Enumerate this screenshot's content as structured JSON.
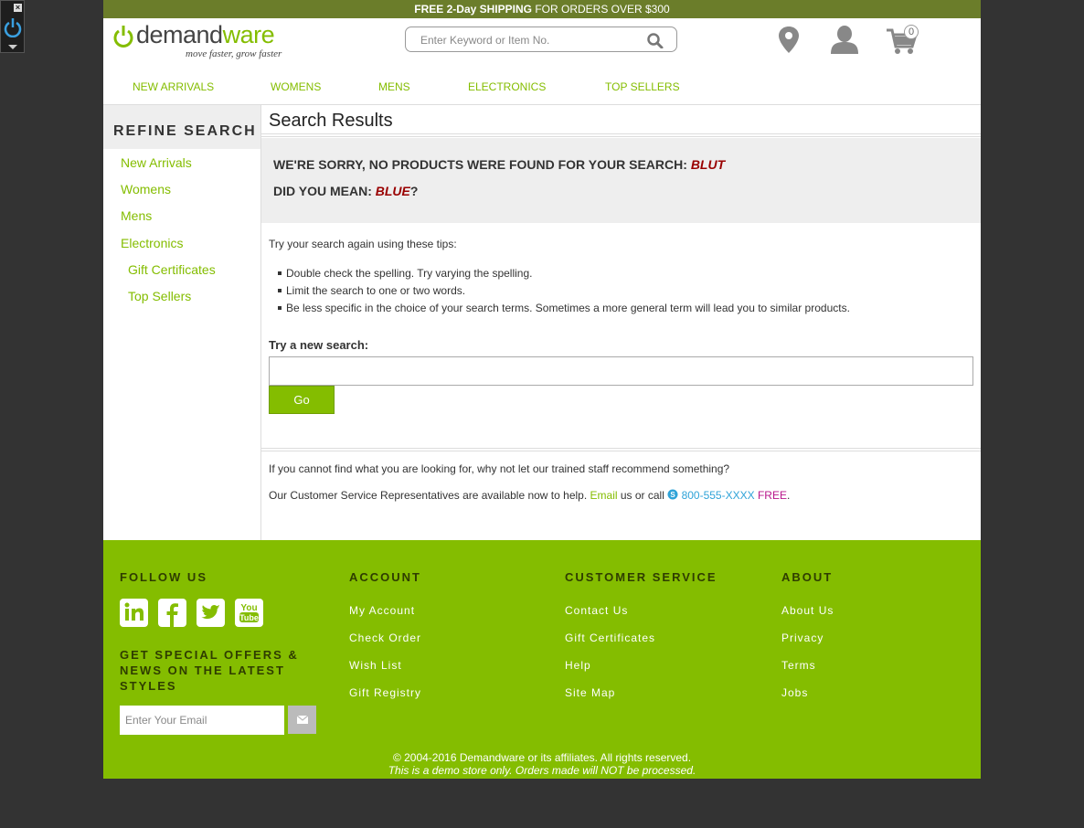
{
  "promo": {
    "bold": "FREE 2-Day SHIPPING",
    "rest": " FOR ORDERS OVER $300"
  },
  "logo": {
    "pre": "demand",
    "post": "ware",
    "tagline": "move faster, grow faster"
  },
  "search": {
    "placeholder": "Enter Keyword or Item No."
  },
  "cart": {
    "count": "0"
  },
  "nav": [
    "NEW ARRIVALS",
    "WOMENS",
    "MENS",
    "ELECTRONICS",
    "TOP SELLERS"
  ],
  "sidebar": {
    "heading": "REFINE SEARCH",
    "items": [
      "New Arrivals",
      "Womens",
      "Mens",
      "Electronics",
      "Gift Certificates",
      "Top Sellers"
    ]
  },
  "main": {
    "title": "Search Results",
    "sorry_prefix": "WE'RE SORRY, NO PRODUCTS WERE FOUND FOR YOUR SEARCH: ",
    "sorry_term": "BLUT",
    "didyoumean_prefix": "DID YOU MEAN: ",
    "didyoumean_term": "BLUE",
    "didyoumean_suffix": "?",
    "tips_intro": "Try your search again using these tips:",
    "tips": [
      "Double check the spelling. Try varying the spelling.",
      "Limit the search to one or two words.",
      "Be less specific in the choice of your search terms. Sometimes a more general term will lead you to similar products."
    ],
    "new_search_label": "Try a new search:",
    "go_label": "Go",
    "help_line1": "If you cannot find what you are looking for, why not let our trained staff recommend something?",
    "help_line2_prefix": "Our Customer Service Representatives are available now to help. ",
    "help_email": "Email",
    "help_mid": " us or call ",
    "help_phone": "800-555-XXXX",
    "help_free": " FREE",
    "help_end": "."
  },
  "footer": {
    "follow": "FOLLOW US",
    "offers": "GET SPECIAL OFFERS & NEWS ON THE LATEST STYLES",
    "email_placeholder": "Enter Your Email",
    "columns": [
      {
        "title": "ACCOUNT",
        "links": [
          "My Account",
          "Check Order",
          "Wish List",
          "Gift Registry"
        ]
      },
      {
        "title": "CUSTOMER SERVICE",
        "links": [
          "Contact Us",
          "Gift Certificates",
          "Help",
          "Site Map"
        ]
      },
      {
        "title": "ABOUT",
        "links": [
          "About Us",
          "Privacy",
          "Terms",
          "Jobs"
        ]
      }
    ],
    "copyright": "© 2004-2016 Demandware or its affiliates. All rights reserved.",
    "demo_note": "This is a demo store only. Orders made will NOT be processed."
  },
  "colors": {
    "brand_green": "#84bd00",
    "promo_bar": "#6b7d2a",
    "error_red": "#990000"
  }
}
